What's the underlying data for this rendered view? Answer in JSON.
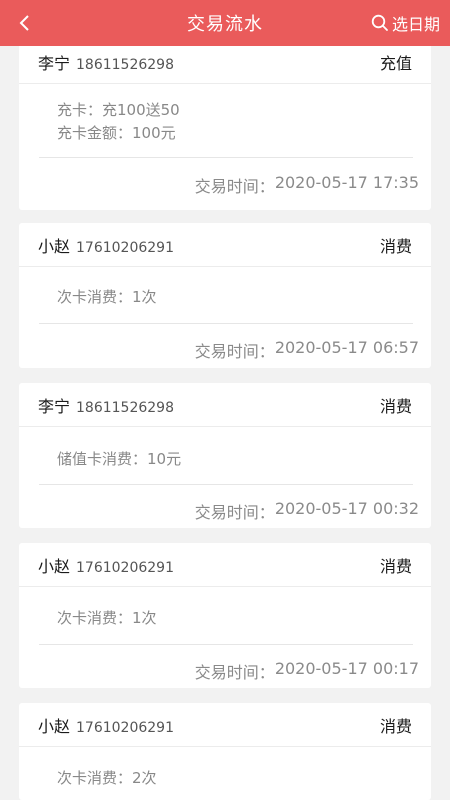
{
  "header": {
    "title": "交易流水",
    "date_filter_label": "选日期"
  },
  "records": [
    {
      "name": "李宁",
      "phone": "18611526298",
      "type": "充值",
      "details": [
        "充卡：充100送50",
        "充卡金额：100元"
      ],
      "time_label": "交易时间：",
      "time": "2020-05-17 17:35"
    },
    {
      "name": "小赵",
      "phone": "17610206291",
      "type": "消费",
      "details": [
        "次卡消费：1次"
      ],
      "time_label": "交易时间：",
      "time": "2020-05-17 06:57"
    },
    {
      "name": "李宁",
      "phone": "18611526298",
      "type": "消费",
      "details": [
        "储值卡消费：10元"
      ],
      "time_label": "交易时间：",
      "time": "2020-05-17 00:32"
    },
    {
      "name": "小赵",
      "phone": "17610206291",
      "type": "消费",
      "details": [
        "次卡消费：1次"
      ],
      "time_label": "交易时间：",
      "time": "2020-05-17 00:17"
    },
    {
      "name": "小赵",
      "phone": "17610206291",
      "type": "消费",
      "details": [
        "次卡消费：2次"
      ],
      "time_label": "",
      "time": ""
    }
  ]
}
